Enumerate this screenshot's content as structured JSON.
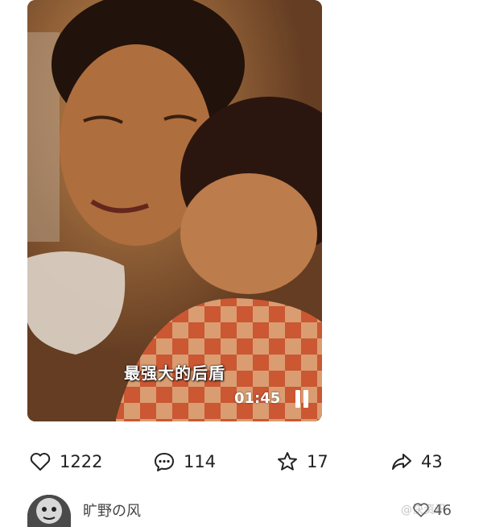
{
  "video": {
    "caption": "最强大的后盾",
    "duration": "01:45",
    "state": "playing"
  },
  "actions": {
    "like": {
      "icon": "heart-icon",
      "count": "1222"
    },
    "comment": {
      "icon": "comment-bubble-icon",
      "count": "114"
    },
    "favorite": {
      "icon": "star-icon",
      "count": "17"
    },
    "share": {
      "icon": "share-arrow-icon",
      "count": "43"
    }
  },
  "comment": {
    "username": "旷野の风",
    "like_count": "46",
    "watermark": "@快资讯"
  }
}
